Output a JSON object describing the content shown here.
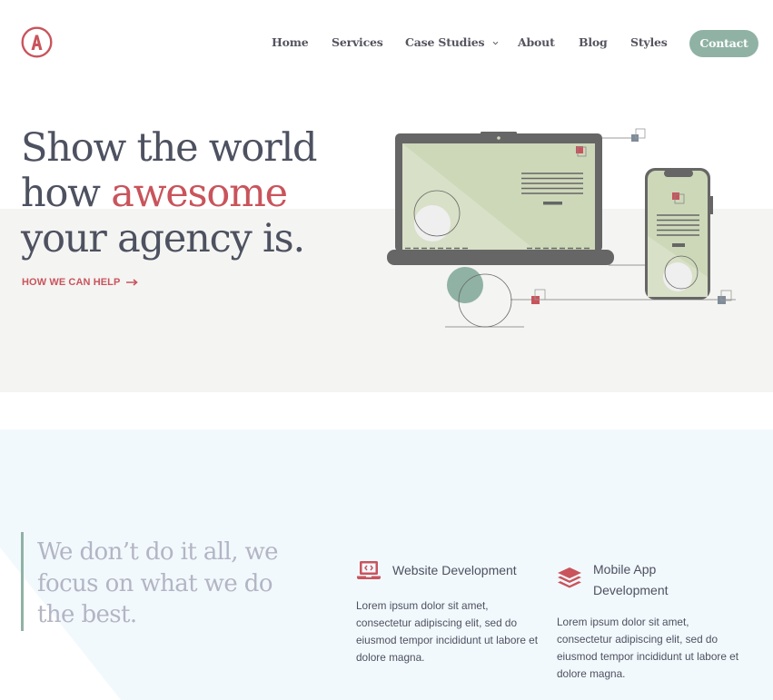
{
  "brand": {
    "logo_letter": "A",
    "accent_color": "#c9545c",
    "secondary_color": "#8fb2a4",
    "text_color": "#4d5160"
  },
  "nav": {
    "items": [
      {
        "label": "Home"
      },
      {
        "label": "Services"
      },
      {
        "label": "Case Studies",
        "has_dropdown": true
      },
      {
        "label": "About"
      },
      {
        "label": "Blog"
      },
      {
        "label": "Styles"
      }
    ],
    "cta_label": "Contact"
  },
  "hero": {
    "title_line1": "Show the world",
    "title_line2_prefix": "how ",
    "title_line2_accent": "awesome",
    "title_line3": "your agency is.",
    "link_label": "HOW WE CAN HELP",
    "link_icon": "arrow-right-icon",
    "illustration": "laptop-and-phone-illustration"
  },
  "services": {
    "quote": "We don’t do it all, we focus on what we do the best.",
    "items": [
      {
        "icon": "laptop-code-icon",
        "title": "Website Development",
        "description": "Lorem ipsum dolor sit amet, consectetur adipiscing elit, sed do eiusmod tempor incididunt ut labore et dolore magna."
      },
      {
        "icon": "layers-icon",
        "title": "Mobile App Development",
        "description": "Lorem ipsum dolor sit amet, consectetur adipiscing elit, sed do eiusmod tempor incididunt ut labore et dolore magna."
      }
    ]
  }
}
